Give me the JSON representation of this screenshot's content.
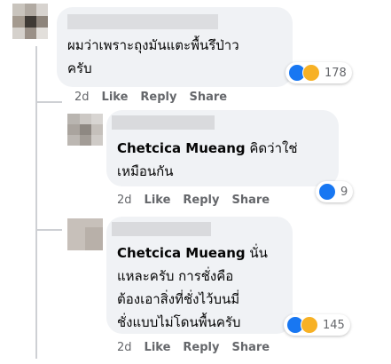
{
  "comments": [
    {
      "text": "ผมว่าเพราะถุงมันแตะพื้นรึป่าว\nครับ",
      "author": "",
      "reaction_count": "178",
      "time": "2d"
    },
    {
      "author": "Chetcica Mueang",
      "text": " คิดว่าใช่\nเหมือนกัน",
      "reaction_count": "9",
      "time": "2d"
    },
    {
      "author": "Chetcica Mueang",
      "text": " นั่น\nแหละครับ การชั่งคือ\nต้องเอาสิ่งที่ชั่งไว้บนมี่\nชั่งแบบไม่โดนพื้นครับ",
      "reaction_count": "145",
      "time": "2d"
    }
  ],
  "actions": {
    "like": "Like",
    "reply": "Reply",
    "share": "Share"
  },
  "colors": {
    "bubble": "#f0f2f5",
    "like": "#1877f2",
    "haha": "#f7b125",
    "meta": "#65676b"
  }
}
